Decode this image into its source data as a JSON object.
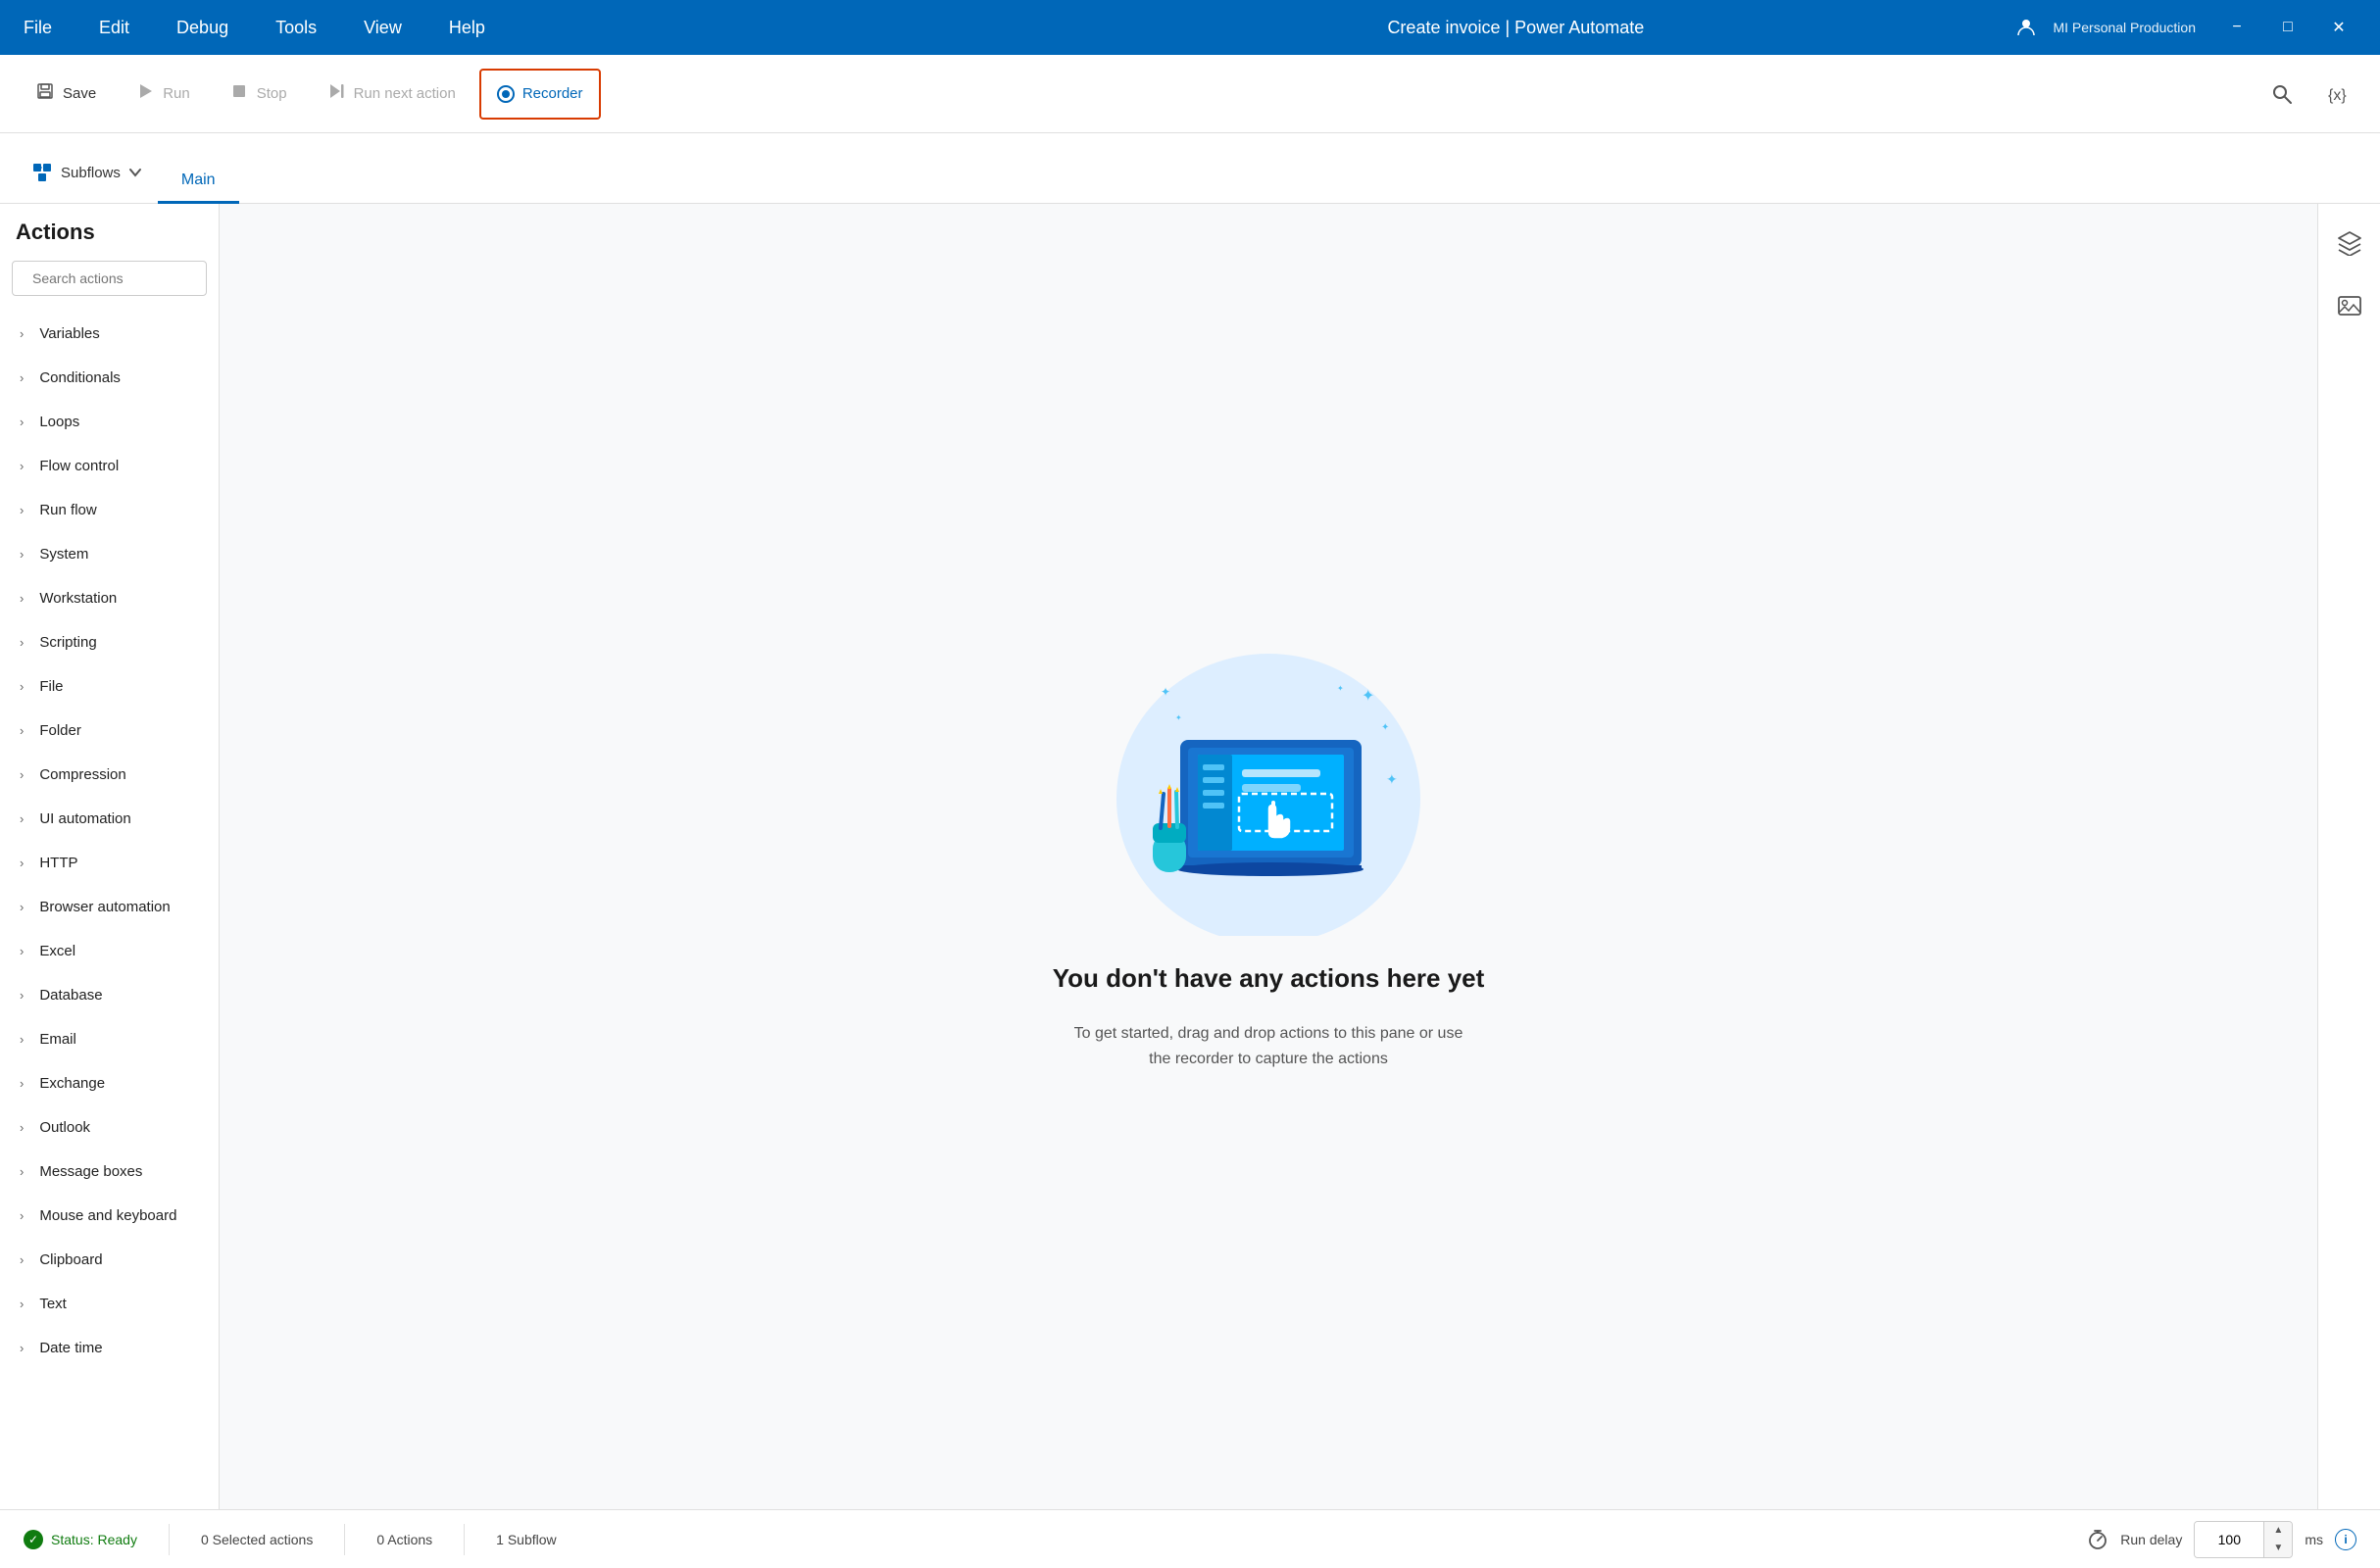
{
  "titlebar": {
    "menu_items": [
      "File",
      "Edit",
      "Debug",
      "Tools",
      "View",
      "Help"
    ],
    "title": "Create invoice | Power Automate",
    "user": "MI Personal Production",
    "controls": [
      "minimize",
      "maximize",
      "close"
    ]
  },
  "toolbar": {
    "save_label": "Save",
    "run_label": "Run",
    "stop_label": "Stop",
    "run_next_label": "Run next action",
    "recorder_label": "Recorder"
  },
  "tabbar": {
    "subflows_label": "Subflows",
    "main_tab_label": "Main"
  },
  "sidebar": {
    "header": "Actions",
    "search_placeholder": "Search actions",
    "items": [
      {
        "label": "Variables"
      },
      {
        "label": "Conditionals"
      },
      {
        "label": "Loops"
      },
      {
        "label": "Flow control"
      },
      {
        "label": "Run flow"
      },
      {
        "label": "System"
      },
      {
        "label": "Workstation"
      },
      {
        "label": "Scripting"
      },
      {
        "label": "File"
      },
      {
        "label": "Folder"
      },
      {
        "label": "Compression"
      },
      {
        "label": "UI automation"
      },
      {
        "label": "HTTP"
      },
      {
        "label": "Browser automation"
      },
      {
        "label": "Excel"
      },
      {
        "label": "Database"
      },
      {
        "label": "Email"
      },
      {
        "label": "Exchange"
      },
      {
        "label": "Outlook"
      },
      {
        "label": "Message boxes"
      },
      {
        "label": "Mouse and keyboard"
      },
      {
        "label": "Clipboard"
      },
      {
        "label": "Text"
      },
      {
        "label": "Date time"
      }
    ]
  },
  "empty_state": {
    "title": "You don't have any actions here yet",
    "subtitle": "To get started, drag and drop actions to this pane\nor use the recorder to capture the actions"
  },
  "statusbar": {
    "status_label": "Status: Ready",
    "selected_actions": "0 Selected actions",
    "actions_count": "0 Actions",
    "subflow_count": "1 Subflow",
    "run_delay_label": "Run delay",
    "run_delay_value": "100",
    "run_delay_unit": "ms"
  }
}
